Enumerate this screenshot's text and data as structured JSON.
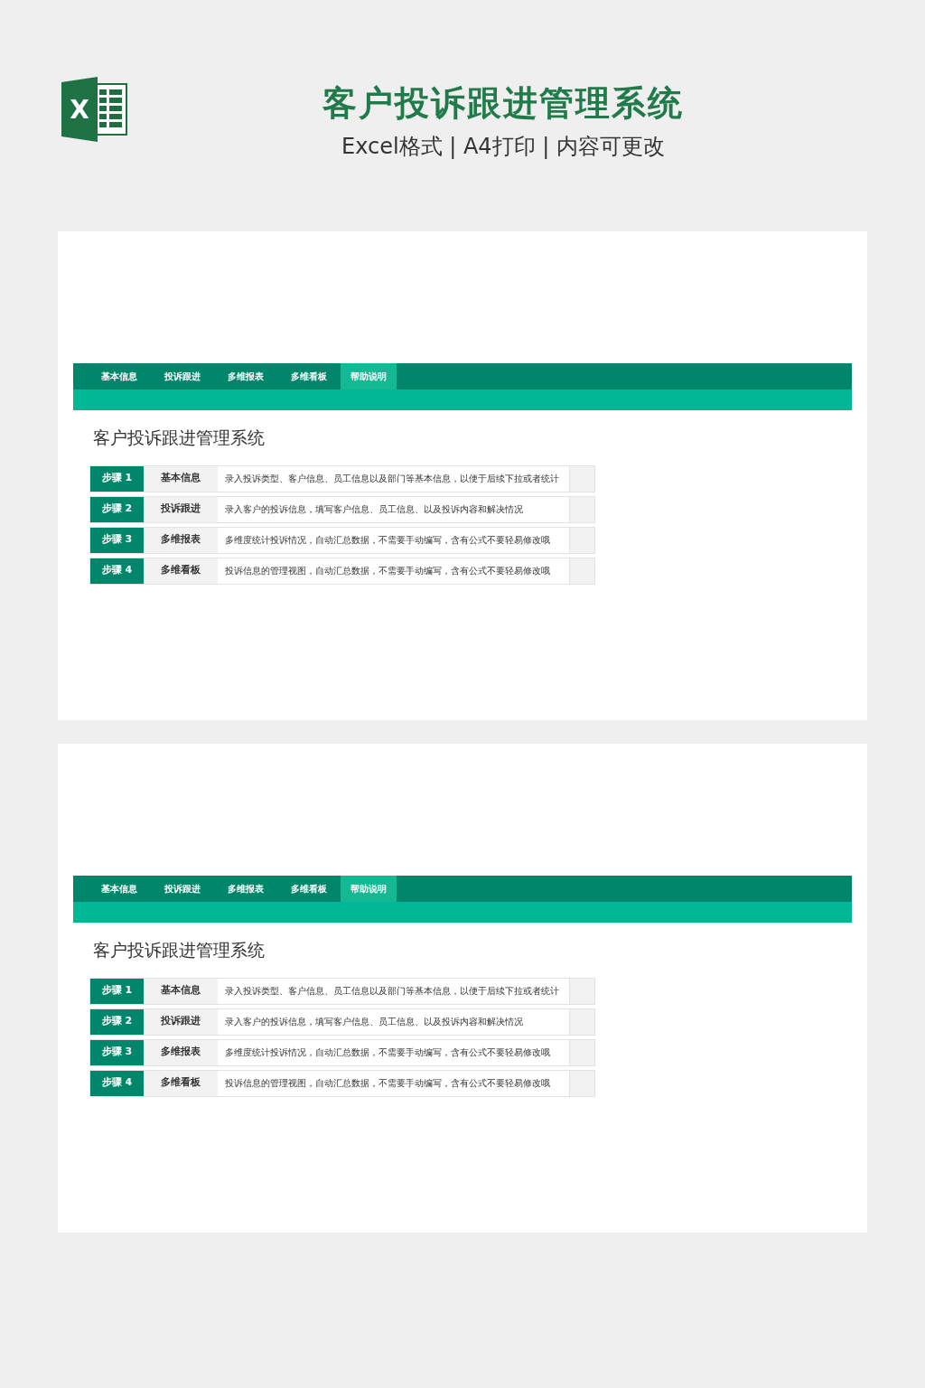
{
  "header": {
    "logo_letter": "X",
    "title": "客户投诉跟进管理系统",
    "subtitle": "Excel格式 | A4打印 | 内容可更改"
  },
  "panels": [
    {
      "tabs": [
        {
          "label": "基本信息",
          "selected": false
        },
        {
          "label": "投诉跟进",
          "selected": false
        },
        {
          "label": "多维报表",
          "selected": false
        },
        {
          "label": "多维看板",
          "selected": false
        },
        {
          "label": "帮助说明",
          "selected": true
        }
      ],
      "heading": "客户投诉跟进管理系统",
      "steps": [
        {
          "step": "步骤 1",
          "name": "基本信息",
          "description": "录入投诉类型、客户信息、员工信息以及部门等基本信息，以便于后续下拉或者统计"
        },
        {
          "step": "步骤 2",
          "name": "投诉跟进",
          "description": "录入客户的投诉信息，填写客户信息、员工信息、以及投诉内容和解决情况"
        },
        {
          "step": "步骤 3",
          "name": "多维报表",
          "description": "多维度统计投诉情况，自动汇总数据，不需要手动编写，含有公式不要轻易修改哦"
        },
        {
          "step": "步骤 4",
          "name": "多维看板",
          "description": "投诉信息的管理视图，自动汇总数据，不需要手动编写，含有公式不要轻易修改哦"
        }
      ]
    },
    {
      "tabs": [
        {
          "label": "基本信息",
          "selected": false
        },
        {
          "label": "投诉跟进",
          "selected": false
        },
        {
          "label": "多维报表",
          "selected": false
        },
        {
          "label": "多维看板",
          "selected": false
        },
        {
          "label": "帮助说明",
          "selected": true
        }
      ],
      "heading": "客户投诉跟进管理系统",
      "steps": [
        {
          "step": "步骤 1",
          "name": "基本信息",
          "description": "录入投诉类型、客户信息、员工信息以及部门等基本信息，以便于后续下拉或者统计"
        },
        {
          "step": "步骤 2",
          "name": "投诉跟进",
          "description": "录入客户的投诉信息，填写客户信息、员工信息、以及投诉内容和解决情况"
        },
        {
          "step": "步骤 3",
          "name": "多维报表",
          "description": "多维度统计投诉情况，自动汇总数据，不需要手动编写，含有公式不要轻易修改哦"
        },
        {
          "step": "步骤 4",
          "name": "多维看板",
          "description": "投诉信息的管理视图，自动汇总数据，不需要手动编写，含有公式不要轻易修改哦"
        }
      ]
    }
  ]
}
